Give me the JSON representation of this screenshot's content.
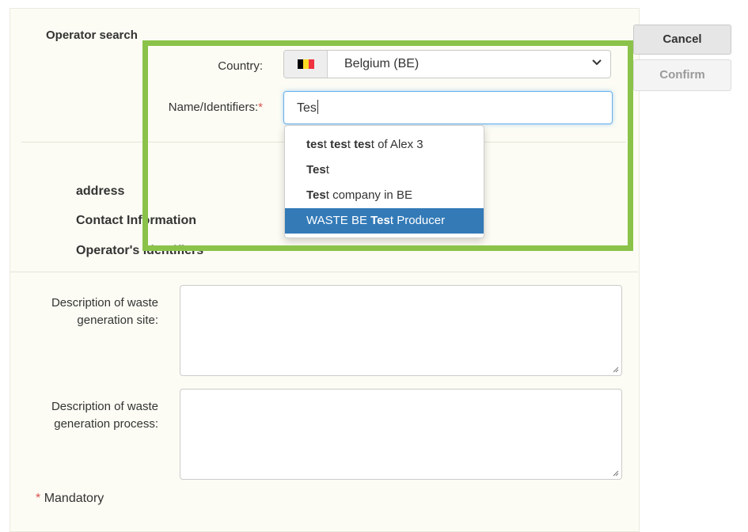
{
  "operator_search": {
    "title": "Operator search",
    "country_label": "Country:",
    "country_value": "Belgium (BE)",
    "country_flag_colors": [
      "#000000",
      "#FDDA24",
      "#EF3340"
    ],
    "name_label": "Name/Identifiers:",
    "required_mark": "*",
    "name_value": "Tes"
  },
  "suggestions": [
    {
      "segments": [
        {
          "text": "tes",
          "bold": true
        },
        {
          "text": "t ",
          "bold": false
        },
        {
          "text": "tes",
          "bold": true
        },
        {
          "text": "t ",
          "bold": false
        },
        {
          "text": "tes",
          "bold": true
        },
        {
          "text": "t of Alex 3",
          "bold": false
        }
      ],
      "active": false
    },
    {
      "segments": [
        {
          "text": "Tes",
          "bold": true
        },
        {
          "text": "t",
          "bold": false
        }
      ],
      "active": false
    },
    {
      "segments": [
        {
          "text": "Tes",
          "bold": true
        },
        {
          "text": "t company in BE",
          "bold": false
        }
      ],
      "active": false
    },
    {
      "segments": [
        {
          "text": "WASTE BE ",
          "bold": false
        },
        {
          "text": "Tes",
          "bold": true
        },
        {
          "text": "t Producer",
          "bold": false
        }
      ],
      "active": true
    }
  ],
  "sections": {
    "address": "address",
    "contact": "Contact Information",
    "identifiers": "Operator's identifiers"
  },
  "buttons": {
    "cancel": "Cancel",
    "confirm": "Confirm"
  },
  "fields": {
    "site_label_1": "Description of waste",
    "site_label_2": "generation site:",
    "process_label_1": "Description of waste",
    "process_label_2": "generation process:"
  },
  "footer": {
    "mandatory_mark": "*",
    "mandatory_text": "Mandatory"
  },
  "colors": {
    "highlight": "#8bc34a",
    "active_suggestion": "#337ab7",
    "required": "#d9534f"
  },
  "icons": {
    "select_arrow": "chevron-down-icon",
    "resize": "resize-grip-icon"
  }
}
